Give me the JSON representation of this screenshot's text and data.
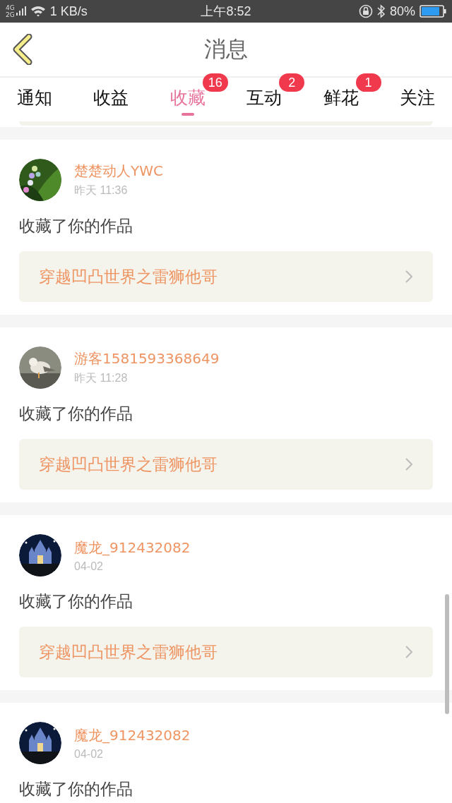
{
  "status_bar": {
    "network": "4G 2G",
    "speed": "1 KB/s",
    "time": "上午8:52",
    "battery": "80%"
  },
  "header": {
    "title": "消息"
  },
  "tabs": [
    {
      "label": "通知",
      "selected": false
    },
    {
      "label": "收益",
      "selected": false
    },
    {
      "label": "收藏",
      "selected": true,
      "badge": "16"
    },
    {
      "label": "互动",
      "selected": false,
      "badge": "2"
    },
    {
      "label": "鲜花",
      "selected": false,
      "badge": "1"
    },
    {
      "label": "关注",
      "selected": false
    }
  ],
  "messages": [
    {
      "user": "楚楚动人YWC",
      "time": "昨天 11:36",
      "action": "收藏了你的作品",
      "work": "穿越凹凸世界之雷狮他哥"
    },
    {
      "user": "游客1581593368649",
      "time": "昨天 11:28",
      "action": "收藏了你的作品",
      "work": "穿越凹凸世界之雷狮他哥"
    },
    {
      "user": "魔龙_912432082",
      "time": "04-02",
      "action": "收藏了你的作品",
      "work": "穿越凹凸世界之雷狮他哥"
    },
    {
      "user": "魔龙_912432082",
      "time": "04-02",
      "action": "收藏了你的作品"
    }
  ]
}
